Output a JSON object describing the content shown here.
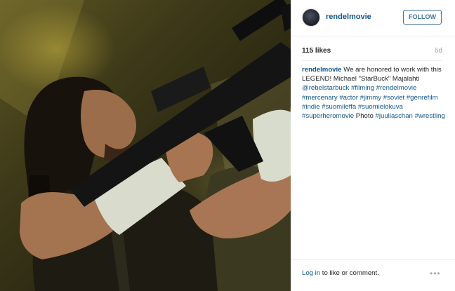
{
  "header": {
    "username": "rendelmovie",
    "follow_label": "FOLLOW"
  },
  "stats": {
    "likes": "115 likes",
    "age": "6d"
  },
  "caption": {
    "author": "rendelmovie",
    "segments": [
      {
        "type": "text",
        "value": " We are honored to work with this LEGEND! Michael \"StarBuck\" Majalahti "
      },
      {
        "type": "mention",
        "value": "@rebelstarbuck"
      },
      {
        "type": "text",
        "value": " "
      },
      {
        "type": "tag",
        "value": "#filming"
      },
      {
        "type": "text",
        "value": " "
      },
      {
        "type": "tag",
        "value": "#rendelmovie"
      },
      {
        "type": "text",
        "value": " "
      },
      {
        "type": "tag",
        "value": "#mercenary"
      },
      {
        "type": "text",
        "value": " "
      },
      {
        "type": "tag",
        "value": "#actor"
      },
      {
        "type": "text",
        "value": " "
      },
      {
        "type": "tag",
        "value": "#jimmy"
      },
      {
        "type": "text",
        "value": " "
      },
      {
        "type": "tag",
        "value": "#soviet"
      },
      {
        "type": "text",
        "value": " "
      },
      {
        "type": "tag",
        "value": "#genrefilm"
      },
      {
        "type": "text",
        "value": " "
      },
      {
        "type": "tag",
        "value": "#indie"
      },
      {
        "type": "text",
        "value": " "
      },
      {
        "type": "tag",
        "value": "#suomileffa"
      },
      {
        "type": "text",
        "value": " "
      },
      {
        "type": "tag",
        "value": "#suomielokuva"
      },
      {
        "type": "text",
        "value": " "
      },
      {
        "type": "tag",
        "value": "#superheromovie"
      },
      {
        "type": "text",
        "value": " Photo "
      },
      {
        "type": "tag",
        "value": "#juuliaschan"
      },
      {
        "type": "text",
        "value": " "
      },
      {
        "type": "tag",
        "value": "#wrestling"
      }
    ]
  },
  "footer": {
    "login_link": "Log in",
    "login_rest": " to like or comment.",
    "more_icon": "ellipsis-icon",
    "more_glyph": "•••"
  },
  "colors": {
    "link": "#125688",
    "button": "#3f729b",
    "muted": "#a5a7aa",
    "text": "#262626"
  }
}
